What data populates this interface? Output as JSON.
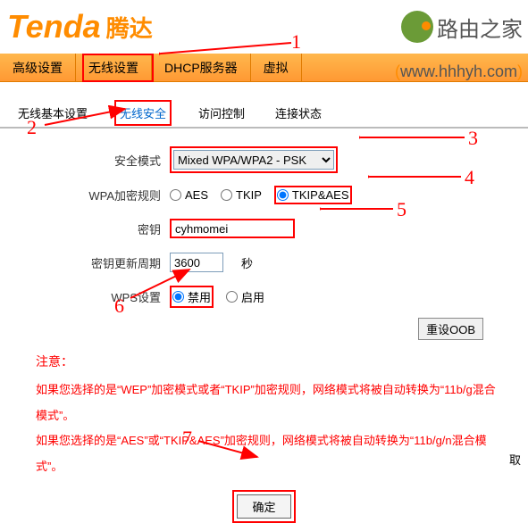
{
  "brand": {
    "en": "Tenda",
    "cn": "腾达"
  },
  "watermark": {
    "text": "路由之家",
    "url_open": "(",
    "url": "www.hhhyh.com",
    "url_close": ")"
  },
  "nav": {
    "items": [
      "高级设置",
      "无线设置",
      "DHCP服务器",
      "虚拟"
    ],
    "active": 1
  },
  "subnav": {
    "items": [
      "无线基本设置",
      "无线安全",
      "访问控制",
      "连接状态"
    ],
    "active": 1
  },
  "form": {
    "security_mode_label": "安全模式",
    "security_mode_value": "Mixed WPA/WPA2 - PSK",
    "wpa_rule_label": "WPA加密规则",
    "wpa_options": {
      "aes": "AES",
      "tkip": "TKIP",
      "both": "TKIP&AES"
    },
    "wpa_selected": "both",
    "key_label": "密钥",
    "key_value": "cyhmomei",
    "renew_label": "密钥更新周期",
    "renew_value": "3600",
    "renew_unit": "秒",
    "wps_label": "WPS设置",
    "wps_options": {
      "disable": "禁用",
      "enable": "启用"
    },
    "wps_selected": "disable",
    "reset_oob": "重设OOB"
  },
  "notes": {
    "title": "注意：",
    "line1": "如果您选择的是“WEP”加密模式或者“TKIP”加密规则，网络模式将被自动转换为“11b/g混合模式”。",
    "line2": "如果您选择的是“AES”或“TKIP&AES”加密规则，网络模式将被自动转换为“11b/g/n混合模式”。"
  },
  "buttons": {
    "ok": "确定",
    "cancel": "取"
  },
  "annotations": {
    "n1": "1",
    "n2": "2",
    "n3": "3",
    "n4": "4",
    "n5": "5",
    "n6": "6",
    "n7": "7"
  }
}
